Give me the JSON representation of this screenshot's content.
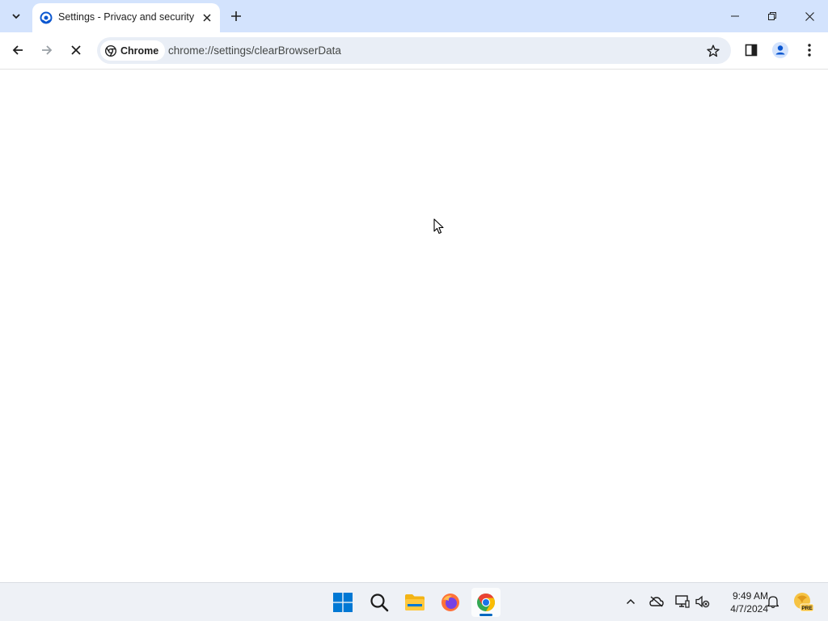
{
  "browser": {
    "tab": {
      "title": "Settings - Privacy and security"
    },
    "omnibox": {
      "chip_label": "Chrome",
      "url": "chrome://settings/clearBrowserData"
    }
  },
  "icons": {
    "tab_search": "chevron-down-icon",
    "tab_favicon": "settings-gear-icon",
    "tab_close": "close-icon",
    "new_tab": "plus-icon",
    "minimize": "minimize-icon",
    "maximize": "restore-icon",
    "close_window": "close-icon",
    "back": "arrow-left-icon",
    "forward": "arrow-right-icon",
    "stop": "stop-x-icon",
    "chrome_chip": "chrome-logo-icon",
    "bookmark": "star-icon",
    "side_panel": "side-panel-icon",
    "profile": "person-icon",
    "menu": "kebab-menu-icon"
  },
  "taskbar": {
    "apps": [
      "Start",
      "Search",
      "File Explorer",
      "Firefox",
      "Chrome"
    ],
    "clock": {
      "time": "9:49 AM",
      "date": "4/7/2024"
    },
    "tray_badge": "PRE"
  },
  "colors": {
    "tabstrip_bg": "#d3e3fd",
    "omnibox_bg": "#e9eef6",
    "taskbar_bg": "#eef1f6",
    "accent": "#0b57d0",
    "windows_blue": "#0078d4"
  }
}
